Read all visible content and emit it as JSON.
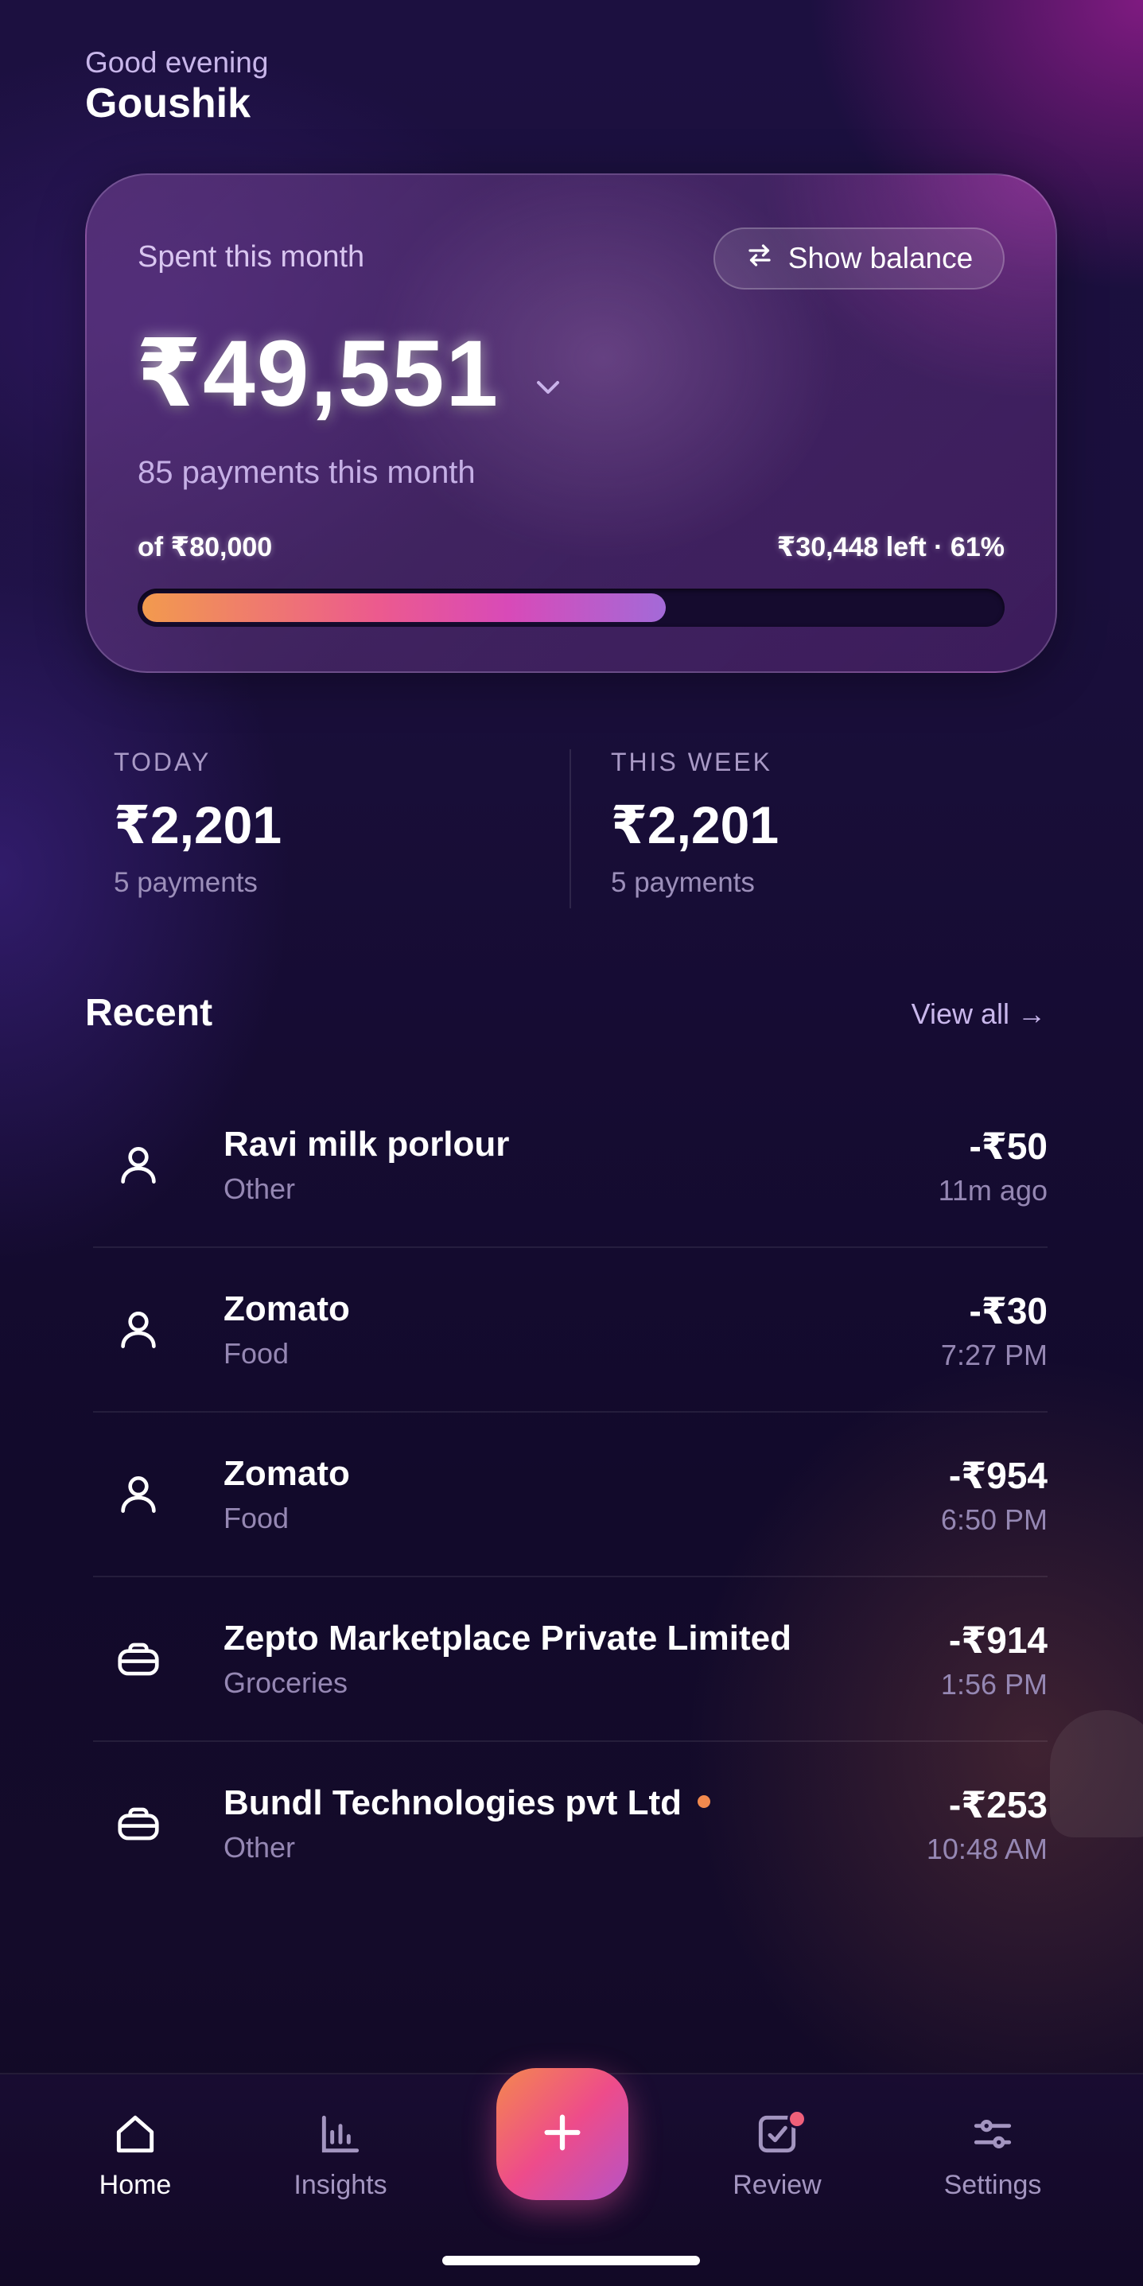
{
  "header": {
    "greeting": "Good evening",
    "user_name": "Goushik"
  },
  "spend_card": {
    "label": "Spent this month",
    "toggle_label": "Show balance",
    "amount": "₹49,551",
    "payments_text": "85 payments this month",
    "budget_text": "of ₹80,000",
    "remaining_text": "₹30,448 left · 61%",
    "progress_fraction": 0.61
  },
  "stats": {
    "today": {
      "label": "TODAY",
      "value": "₹2,201",
      "sub": "5 payments"
    },
    "week": {
      "label": "THIS WEEK",
      "value": "₹2,201",
      "sub": "5 payments"
    }
  },
  "recent": {
    "title": "Recent",
    "view_all": "View all →",
    "transactions": [
      {
        "name": "Ravi milk porlour",
        "category": "Other",
        "amount": "-₹50",
        "time": "11m ago",
        "icon": "person-icon"
      },
      {
        "name": "Zomato",
        "category": "Food",
        "amount": "-₹30",
        "time": "7:27 PM",
        "icon": "person-icon"
      },
      {
        "name": "Zomato",
        "category": "Food",
        "amount": "-₹954",
        "time": "6:50 PM",
        "icon": "person-icon"
      },
      {
        "name": "Zepto Marketplace Private Limited",
        "category": "Groceries",
        "amount": "-₹914",
        "time": "1:56 PM",
        "icon": "merchant-icon"
      },
      {
        "name": "Bundl Technologies pvt Ltd",
        "category": "Other",
        "amount": "-₹253",
        "time": "10:48 AM",
        "icon": "merchant-icon",
        "unread": true
      }
    ]
  },
  "nav": {
    "home": "Home",
    "insights": "Insights",
    "review": "Review",
    "settings": "Settings"
  },
  "colors": {
    "accent_start": "#f29a4e",
    "accent_mid": "#ec5a8e",
    "accent_end": "#a36ad8",
    "unread_dot": "#f28a4e"
  }
}
